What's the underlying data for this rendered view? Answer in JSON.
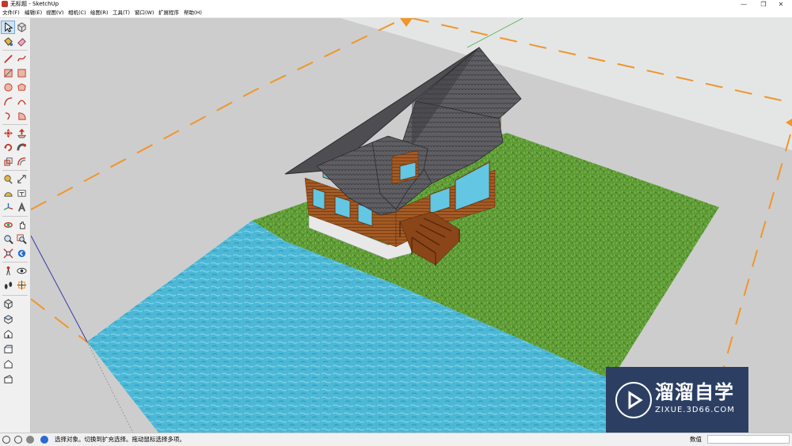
{
  "window": {
    "title": "无标题 - SketchUp",
    "minimize": "—",
    "restore": "❐",
    "close": "✕"
  },
  "menu": [
    "文件(F)",
    "编辑(E)",
    "视图(V)",
    "相机(C)",
    "绘图(R)",
    "工具(T)",
    "窗口(W)",
    "扩展程序",
    "帮助(H)"
  ],
  "toolbar": {
    "icons": [
      "select-icon",
      "make-component-icon",
      "paint-bucket-icon",
      "eraser-icon",
      "line-icon",
      "freehand-icon",
      "rectangle-icon",
      "rotated-rectangle-icon",
      "circle-icon",
      "polygon-icon",
      "arc-icon",
      "two-point-arc-icon",
      "three-point-arc-icon",
      "pie-icon",
      "move-icon",
      "push-pull-icon",
      "rotate-icon",
      "follow-me-icon",
      "scale-icon",
      "offset-icon",
      "tape-measure-icon",
      "dimension-icon",
      "protractor-icon",
      "text-icon",
      "axes-icon",
      "3d-text-icon",
      "orbit-icon",
      "pan-icon",
      "zoom-icon",
      "zoom-window-icon",
      "zoom-extents-icon",
      "previous-view-icon",
      "position-camera-icon",
      "look-around-icon",
      "walk-icon",
      "section-plane-icon",
      "iso-view-icon",
      "top-view-icon",
      "front-view-icon",
      "right-view-icon",
      "back-view-icon",
      "left-view-icon"
    ]
  },
  "status": {
    "text": "选择对象。切换到扩充选择。拖动鼠标选择多项。",
    "value_label": "数值",
    "value": ""
  },
  "watermark": {
    "text_cn": "溜溜自学",
    "text_en": "ZIXUE.3D66.COM"
  },
  "colors": {
    "ground": "#cdcdcd",
    "sky": "#e4e6e6",
    "grass": "#5e9a36",
    "water": "#4cb8d6",
    "roof": "#5a5a5e",
    "wall": "#a45a24",
    "window": "#63c6e3",
    "dash": "#f0962b",
    "watermark_bg": "#2c3f63"
  }
}
